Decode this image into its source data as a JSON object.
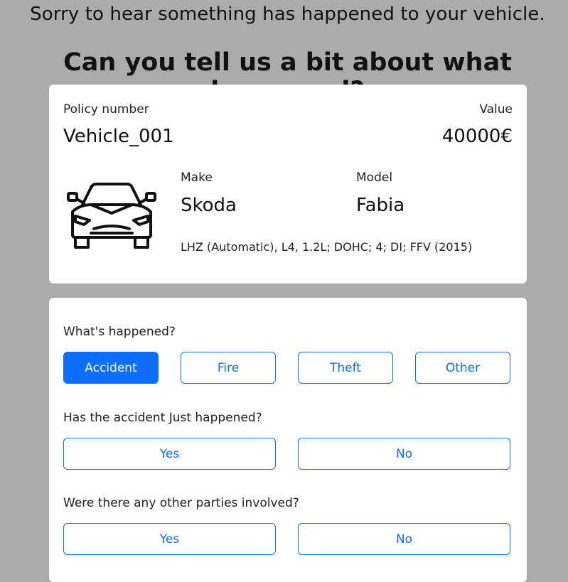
{
  "header": {
    "subtitle": "Sorry to hear something has happened to your vehicle.",
    "title": "Can you tell us a bit about what happened?"
  },
  "vehicle": {
    "policy_label": "Policy number",
    "policy_number": "Vehicle_001",
    "value_label": "Value",
    "value": "40000€",
    "make_label": "Make",
    "make": "Skoda",
    "model_label": "Model",
    "model": "Fabia",
    "spec": "LHZ (Automatic), L4, 1.2L; DOHC; 4; DI; FFV (2015)",
    "icon": "car-icon"
  },
  "questions": {
    "what_happened": {
      "label": "What's happened?",
      "options": [
        "Accident",
        "Fire",
        "Theft",
        "Other"
      ],
      "selected": "Accident"
    },
    "just_happened": {
      "label": "Has the accident Just happened?",
      "options": [
        "Yes",
        "No"
      ]
    },
    "other_parties": {
      "label": "Were there any other parties involved?",
      "options": [
        "Yes",
        "No"
      ]
    }
  },
  "colors": {
    "page_background": "#ababab",
    "card_background": "#ffffff",
    "accent": "#0d6efd"
  }
}
